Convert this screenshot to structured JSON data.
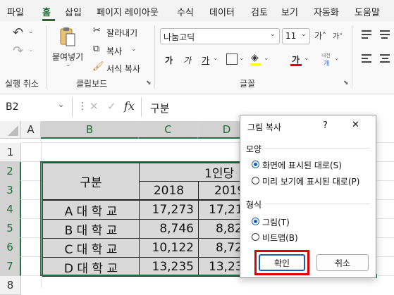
{
  "menu": {
    "tabs": [
      "파일",
      "홈",
      "삽입",
      "페이지 레이아웃",
      "수식",
      "데이터",
      "검토",
      "보기",
      "자동화",
      "도움말"
    ],
    "active_tab": "홈"
  },
  "ribbon": {
    "undo_group_label": "실행 취소",
    "clipboard": {
      "paste_label": "붙여넣기",
      "cut_label": "잘라내기",
      "copy_label": "복사",
      "format_painter_label": "서식 복사",
      "group_label": "클립보드"
    },
    "font": {
      "font_name": "나눔고딕",
      "font_size": "11",
      "bold": "가",
      "italic": "가",
      "underline": "가",
      "font_color_glyph": "가",
      "phonetic_top": "내천",
      "phonetic_bottom": "개",
      "group_label": "글꼴"
    }
  },
  "formula_bar": {
    "name_box": "B2",
    "fx": "fx",
    "content": "구분"
  },
  "sheet": {
    "columns": [
      "A",
      "B",
      "C",
      "D"
    ],
    "rows": [
      "1",
      "2",
      "3",
      "4",
      "5",
      "6",
      "7",
      "8"
    ],
    "header_merged": "구분",
    "header_group": "1인당",
    "header_years": [
      "2018",
      "2019"
    ],
    "data": [
      {
        "name": "A 대 학 교",
        "y2018": "17,273",
        "y2019": "17,21"
      },
      {
        "name": "B 대 학 교",
        "y2018": "8,746",
        "y2019": "8,82"
      },
      {
        "name": "C 대 학 교",
        "y2018": "10,122",
        "y2019": "8,72"
      },
      {
        "name": "D 대 학 교",
        "y2018": "13,235",
        "y2019": "13,23"
      }
    ]
  },
  "dialog": {
    "title": "그림 복사",
    "help": "?",
    "close": "✕",
    "appearance_label": "모양",
    "appearance_options": [
      "화면에 표시된 대로(S)",
      "미리 보기에 표시된 대로(P)"
    ],
    "appearance_selected": 0,
    "format_label": "형식",
    "format_options": [
      "그림(T)",
      "비트맵(B)"
    ],
    "format_selected": 0,
    "ok_label": "확인",
    "cancel_label": "취소"
  },
  "colors": {
    "excel_green": "#217346",
    "highlight_red": "#e00000",
    "radio_blue": "#1a5fb4",
    "font_color_red": "#e00000"
  }
}
